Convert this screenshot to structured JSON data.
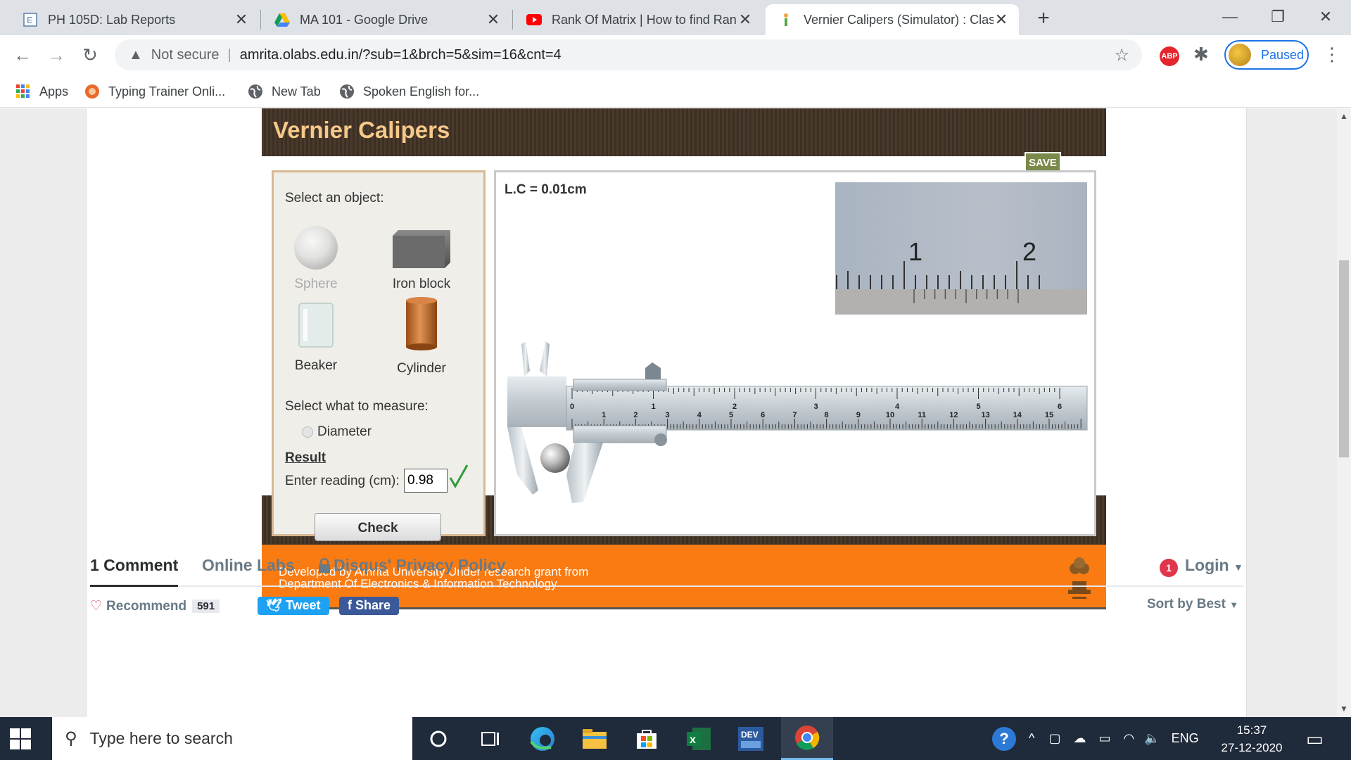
{
  "browser": {
    "tabs": [
      {
        "title": "PH 105D: Lab Reports",
        "icon": "e-letter-icon",
        "active": false
      },
      {
        "title": "MA 101 - Google Drive",
        "icon": "google-drive-icon",
        "active": false
      },
      {
        "title": "Rank Of Matrix | How to find Ran",
        "icon": "youtube-icon",
        "active": false
      },
      {
        "title": "Vernier Calipers (Simulator) : Clas",
        "icon": "olabs-icon",
        "active": true
      }
    ],
    "address": {
      "security_label": "Not secure",
      "url": "amrita.olabs.edu.in/?sub=1&brch=5&sim=16&cnt=4"
    },
    "profile_status": "Paused",
    "abp_label": "ABP",
    "bookmarks": [
      {
        "label": "Apps",
        "icon": "apps-grid-icon"
      },
      {
        "label": "Typing Trainer Onli...",
        "icon": "typing-trainer-icon"
      },
      {
        "label": "New Tab",
        "icon": "globe-icon"
      },
      {
        "label": "Spoken English for...",
        "icon": "globe-icon"
      }
    ]
  },
  "simulator": {
    "title": "Vernier Calipers",
    "save_label": "SAVE",
    "select_object_label": "Select an object:",
    "objects": [
      {
        "label": "Sphere",
        "disabled": true
      },
      {
        "label": "Iron block",
        "disabled": false
      },
      {
        "label": "Beaker",
        "disabled": false
      },
      {
        "label": "Cylinder",
        "disabled": false
      }
    ],
    "measure_label": "Select what to measure:",
    "measure_option": "Diameter",
    "result_label": "Result",
    "reading_label": "Enter reading (cm):",
    "reading_value": "0.98",
    "check_label": "Check",
    "least_count": "L.C = 0.01cm",
    "zoom_main_labels": [
      "1",
      "2"
    ],
    "main_scale_labels": [
      "0",
      "1",
      "2",
      "3",
      "4",
      "5",
      "6"
    ],
    "lower_scale_labels": [
      "1",
      "2",
      "3",
      "4",
      "5",
      "6",
      "7",
      "8",
      "9",
      "10",
      "11",
      "12",
      "13",
      "14",
      "15"
    ],
    "footer_line1": "Developed by Amrita University Under research grant from",
    "footer_line2": "Department Of Electronics & Information Technology"
  },
  "comments": {
    "count_tab": "1 Comment",
    "site_tab": "Online Labs",
    "privacy_tab": "Disqus' Privacy Policy",
    "login_badge": "1",
    "login_label": "Login",
    "recommend_label": "Recommend",
    "recommend_count": "591",
    "tweet_label": "Tweet",
    "share_label": "Share",
    "sort_label": "Sort by Best"
  },
  "taskbar": {
    "search_placeholder": "Type here to search",
    "language": "ENG",
    "time": "15:37",
    "date": "27-12-2020",
    "dev_label": "DEV"
  },
  "colors": {
    "chrome_bg": "#dee1e6",
    "sim_header": "#4a3a2c",
    "sim_title": "#f6c88a",
    "footer_orange": "#fa7b12",
    "taskbar": "#1f2a3a",
    "check_green": "#2e9b3a"
  }
}
